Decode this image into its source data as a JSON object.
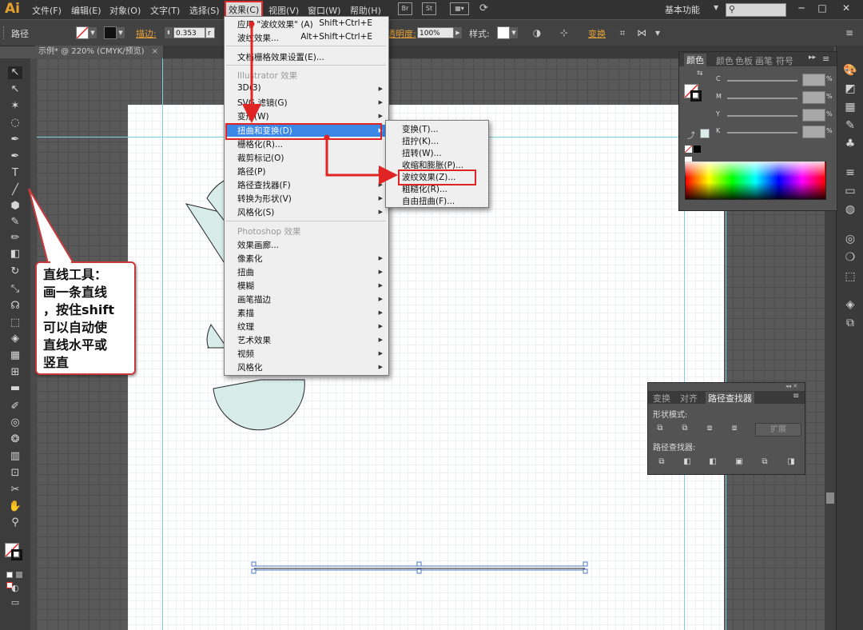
{
  "app": {
    "logo": "Ai"
  },
  "menubar": {
    "items": [
      "文件(F)",
      "编辑(E)",
      "对象(O)",
      "文字(T)",
      "选择(S)",
      "效果(C)",
      "视图(V)",
      "窗口(W)",
      "帮助(H)"
    ],
    "bridge_label": "Br",
    "stock_label": "St",
    "workspace": "基本功能",
    "window_min": "─",
    "window_max": "□",
    "window_close": "✕"
  },
  "controlbar": {
    "object_type": "路径",
    "stroke_label": "描边:",
    "stroke_value": "0.353",
    "stroke_unit": "r",
    "opacity_label": "透明度:",
    "opacity_value": "100%",
    "style_label": "样式:",
    "transform_label": "变换"
  },
  "document": {
    "tab_title": "示例* @ 220% (CMYK/预览)",
    "close": "×"
  },
  "effect_menu": {
    "items": [
      {
        "label": "应用 \"波纹效果\" (A)",
        "shortcut": "Shift+Ctrl+E"
      },
      {
        "label": "波纹效果...",
        "shortcut": "Alt+Shift+Ctrl+E"
      },
      {
        "label": "文档栅格效果设置(E)..."
      },
      {
        "label": "Illustrator 效果",
        "disabled": true
      },
      {
        "label": "3D(3)",
        "sub": true
      },
      {
        "label": "SVG 滤镜(G)",
        "sub": true
      },
      {
        "label": "变形(W)",
        "sub": true
      },
      {
        "label": "扭曲和变换(D)",
        "sub": true
      },
      {
        "label": "栅格化(R)..."
      },
      {
        "label": "裁剪标记(O)"
      },
      {
        "label": "路径(P)",
        "sub": true
      },
      {
        "label": "路径查找器(F)",
        "sub": true
      },
      {
        "label": "转换为形状(V)",
        "sub": true
      },
      {
        "label": "风格化(S)",
        "sub": true
      },
      {
        "label": "Photoshop 效果",
        "disabled": true
      },
      {
        "label": "效果画廊..."
      },
      {
        "label": "像素化",
        "sub": true
      },
      {
        "label": "扭曲",
        "sub": true
      },
      {
        "label": "模糊",
        "sub": true
      },
      {
        "label": "画笔描边",
        "sub": true
      },
      {
        "label": "素描",
        "sub": true
      },
      {
        "label": "纹理",
        "sub": true
      },
      {
        "label": "艺术效果",
        "sub": true
      },
      {
        "label": "视频",
        "sub": true
      },
      {
        "label": "风格化",
        "sub": true
      }
    ]
  },
  "submenu": {
    "items": [
      "变换(T)...",
      "扭拧(K)...",
      "扭转(W)...",
      "收缩和膨胀(P)...",
      "波纹效果(Z)...",
      "粗糙化(R)...",
      "自由扭曲(F)..."
    ]
  },
  "color_panel": {
    "tabs": [
      "颜色",
      "颜色",
      "色板",
      "画笔",
      "符号"
    ],
    "channels": [
      "C",
      "M",
      "Y",
      "K"
    ],
    "percent": "%",
    "menu": "≡"
  },
  "pathfinder_panel": {
    "tabs": [
      "变换",
      "对齐",
      "路径查找器"
    ],
    "shape_modes_label": "形状模式:",
    "pathfinders_label": "路径查找器:",
    "expand_label": "扩展"
  },
  "callout": {
    "text": "直线工具：\n画一条直线\n，按住shift\n可以自动使\n直线水平或\n竖直"
  },
  "icons": {
    "selection": "↖",
    "direct": "↖",
    "magic": "✶",
    "lasso": "◌",
    "pen": "✒",
    "type": "T",
    "line": "╱",
    "rect": "⬢",
    "brush": "✎",
    "pencil": "✏",
    "eraser": "◧",
    "rotate": "↻",
    "scale": "⤡",
    "warp": "☊",
    "free": "⬚",
    "shape_builder": "◈",
    "perspective": "▦",
    "mesh": "⊞",
    "gradient": "▬",
    "eyedropper": "✐",
    "blend": "◎",
    "symbol": "❂",
    "graph": "▥",
    "artboard": "⊡",
    "slice": "✂",
    "hand": "✋",
    "zoom": "⚲"
  },
  "colors": {
    "menu_highlight": "#3b87e6",
    "annotation_red": "#e02424",
    "shape_fill": "#d8ece8",
    "guide": "#7fd0e0"
  }
}
